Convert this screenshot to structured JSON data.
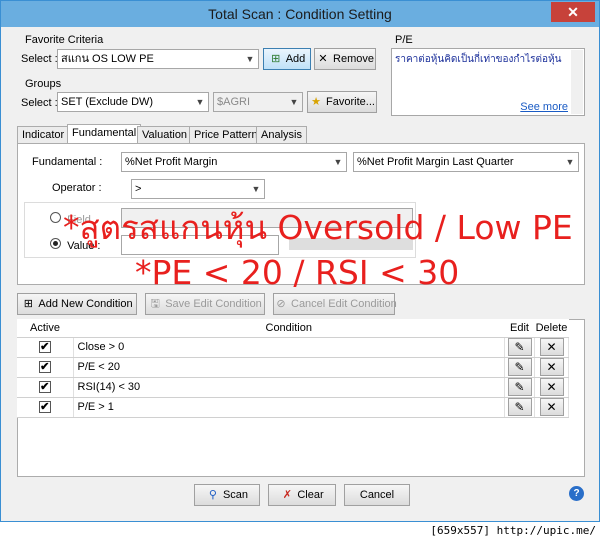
{
  "window": {
    "title": "Total Scan : Condition Setting",
    "close_glyph": "✕"
  },
  "favorite": {
    "group_label": "Favorite Criteria",
    "select_label": "Select :",
    "selected": "สแกน OS LOW PE",
    "add_label": "Add",
    "remove_label": "Remove"
  },
  "groups": {
    "group_label": "Groups",
    "select_label": "Select :",
    "selected": "SET (Exclude DW)",
    "sector": "$AGRI",
    "favorite_label": "Favorite..."
  },
  "pe_box": {
    "label": "P/E",
    "text": "ราคาต่อหุ้นคิดเป็นกี่เท่าของกำไรต่อหุ้น",
    "see_more": "See more"
  },
  "tabs": [
    {
      "label": "Indicator"
    },
    {
      "label": "Fundamental"
    },
    {
      "label": "Valuation"
    },
    {
      "label": "Price Pattern"
    },
    {
      "label": "Analysis"
    }
  ],
  "fundamental": {
    "label": "Fundamental :",
    "field1": "%Net Profit Margin",
    "field2": "%Net Profit Margin Last Quarter",
    "operator_label": "Operator :",
    "operator": ">",
    "field_option_label": "Field",
    "value_label": "Value :",
    "value": ""
  },
  "overlay": {
    "line1": "*สูตรสแกนหุ้น Oversold / Low PE",
    "line2": "*PE < 20 / RSI < 30"
  },
  "condition_buttons": {
    "add": "Add New Condition",
    "save": "Save Edit Condition",
    "cancel": "Cancel Edit Condition"
  },
  "table": {
    "headers": {
      "active": "Active",
      "condition": "Condition",
      "edit": "Edit",
      "delete": "Delete"
    },
    "rows": [
      {
        "active": "✔",
        "condition": "Close > 0"
      },
      {
        "active": "✔",
        "condition": "P/E < 20"
      },
      {
        "active": "✔",
        "condition": "RSI(14) < 30"
      },
      {
        "active": "✔",
        "condition": "P/E > 1"
      }
    ],
    "edit_glyph": "✎",
    "delete_glyph": "✕"
  },
  "actions": {
    "scan": "Scan",
    "clear": "Clear",
    "cancel": "Cancel",
    "help": "?"
  },
  "watermark": "[659x557] http://upic.me/"
}
